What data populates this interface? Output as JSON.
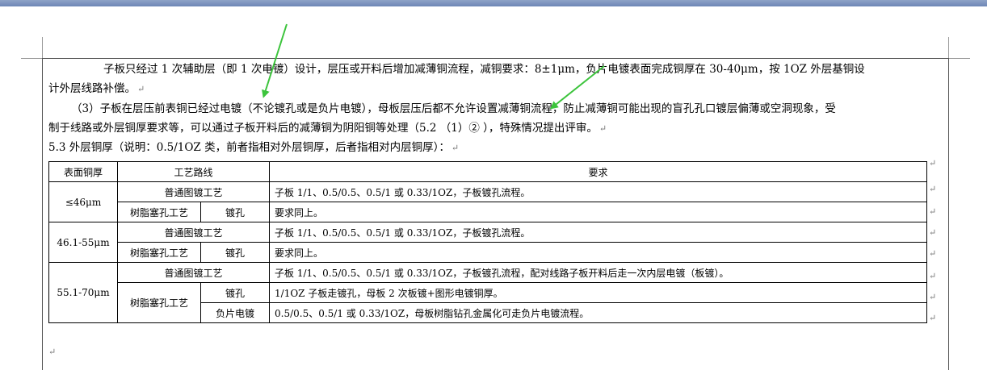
{
  "paragraphs": {
    "p1_line1": "子板只经过 1 次辅助层（即 1 次电镀）设计，层压或开料后增加减薄铜流程，减铜要求：8±1μm，负片电镀表面完成铜厚在 30-40μm，按 1OZ 外层基铜设",
    "p1_line2": "计外层线路补偿。",
    "p2_line1": "（3）子板在层压前表铜已经过电镀（不论镀孔或是负片电镀），母板层压后都不允许设置减薄铜流程，防止减薄铜可能出现的盲孔孔口镀层偏薄或空洞现象，受",
    "p2_line2": "制于线路或外层铜厚要求等，可以通过子板开料后的减薄铜为阴阳铜等处理（5.2 （1）② ），特殊情况提出评审。",
    "heading": "5.3 外层铜厚（说明：0.5/1OZ 类，前者指相对外层铜厚，后者指相对内层铜厚）："
  },
  "paragraph_mark": "↵",
  "table": {
    "headers": [
      "表面铜厚",
      "工艺路线",
      "要求"
    ],
    "groups": [
      {
        "thickness": "≤46μm",
        "rows": [
          {
            "route": "普通图镀工艺",
            "sub": "",
            "requirement": "子板 1/1、0.5/0.5、0.5/1 或 0.33/1OZ，子板镀孔流程。"
          },
          {
            "route": "树脂塞孔工艺",
            "sub": "镀孔",
            "requirement": "要求同上。"
          }
        ]
      },
      {
        "thickness": "46.1-55μm",
        "rows": [
          {
            "route": "普通图镀工艺",
            "sub": "",
            "requirement": "子板 1/1、0.5/0.5、0.5/1 或 0.33/1OZ，子板镀孔流程。"
          },
          {
            "route": "树脂塞孔工艺",
            "sub": "镀孔",
            "requirement": "要求同上。"
          }
        ]
      },
      {
        "thickness": "55.1-70μm",
        "rows": [
          {
            "route": "普通图镀工艺",
            "sub": "",
            "requirement": "子板 1/1、0.5/0.5、0.5/1 或 0.33/1OZ，子板镀孔流程，配对线路子板开料后走一次内层电镀（板镀）。"
          },
          {
            "route": "树脂塞孔工艺",
            "sub": "镀孔",
            "requirement": "1/1OZ 子板走镀孔，母板 2 次板镀+图形电镀铜厚。"
          },
          {
            "route": "",
            "sub": "负片电镀",
            "requirement": "0.5/0.5、0.5/1 或 0.33/1OZ，母板树脂钻孔金属化可走负片电镀流程。"
          }
        ]
      }
    ]
  },
  "colors": {
    "arrow": "#3cc43c",
    "titlebar": "#7b91bf"
  }
}
